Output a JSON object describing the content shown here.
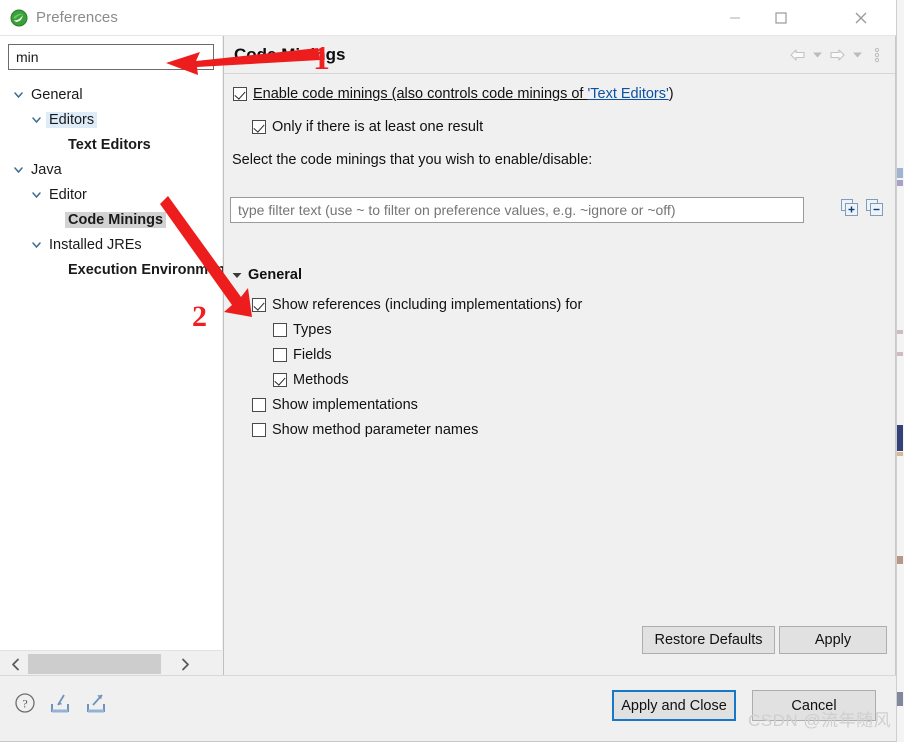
{
  "window": {
    "title": "Preferences",
    "icon": "eclipse-icon",
    "controls": {
      "minimize": "minimize-icon",
      "maximize": "maximize-icon",
      "close": "close-icon"
    }
  },
  "search": {
    "value": "min",
    "placeholder": ""
  },
  "tree": {
    "items": [
      {
        "label": "General",
        "indent": 0,
        "twisty": "expanded",
        "state": "normal"
      },
      {
        "label": "Editors",
        "indent": 1,
        "twisty": "expanded",
        "state": "highlighted"
      },
      {
        "label": "Text Editors",
        "indent": 2,
        "twisty": "none",
        "state": "bold"
      },
      {
        "label": "Java",
        "indent": 0,
        "twisty": "expanded",
        "state": "normal"
      },
      {
        "label": "Editor",
        "indent": 1,
        "twisty": "expanded",
        "state": "normal"
      },
      {
        "label": "Code Minings",
        "indent": 2,
        "twisty": "none",
        "state": "selected"
      },
      {
        "label": "Installed JREs",
        "indent": 1,
        "twisty": "expanded",
        "state": "normal"
      },
      {
        "label": "Execution Environments",
        "indent": 2,
        "twisty": "none",
        "state": "bold"
      }
    ],
    "scrollbar": {
      "left_arrow": "chevron-left-icon",
      "right_arrow": "chevron-right-icon"
    }
  },
  "panel": {
    "title": "Code Minings",
    "nav": {
      "back": "back-arrow-icon",
      "back_menu": "chevron-down-icon",
      "forward": "forward-arrow-icon",
      "forward_menu": "chevron-down-icon",
      "menu": "vertical-dots-icon"
    },
    "enable": {
      "label_pre": "Enable code minings (also controls code minings of ",
      "link": "'Text Editors'",
      "label_post": ")",
      "checked": true
    },
    "only_if": {
      "label": "Only if there is at least one result",
      "checked": true
    },
    "instruction": "Select the code minings that you wish to enable/disable:",
    "filter": {
      "value": "",
      "placeholder": "type filter text (use ~ to filter on preference values, e.g. ~ignore or ~off)"
    },
    "tree_tools": {
      "expand_all": "expand-all-icon",
      "collapse_all": "collapse-all-icon"
    },
    "section": {
      "label": "General",
      "expanded": true
    },
    "options": [
      {
        "label": "Show references (including implementations) for",
        "checked": true,
        "indent": 1
      },
      {
        "label": "Types",
        "checked": false,
        "indent": 2
      },
      {
        "label": "Fields",
        "checked": false,
        "indent": 2
      },
      {
        "label": "Methods",
        "checked": true,
        "indent": 2
      },
      {
        "label": "Show implementations",
        "checked": false,
        "indent": 1
      },
      {
        "label": "Show method parameter names",
        "checked": false,
        "indent": 1
      }
    ],
    "buttons": {
      "restore_defaults": "Restore Defaults",
      "apply": "Apply"
    }
  },
  "footer": {
    "icons": {
      "help": "help-icon",
      "import": "import-icon",
      "export": "export-icon"
    },
    "apply_and_close": "Apply and Close",
    "cancel": "Cancel"
  },
  "annotations": {
    "step1": "1",
    "step2": "2"
  },
  "watermark": "CSDN @流年随风",
  "colors": {
    "accent": "#1878c8",
    "link": "#0b51a3",
    "annotation": "#ef2020",
    "selection": "#d2d2d2",
    "highlight": "#deecf9"
  }
}
